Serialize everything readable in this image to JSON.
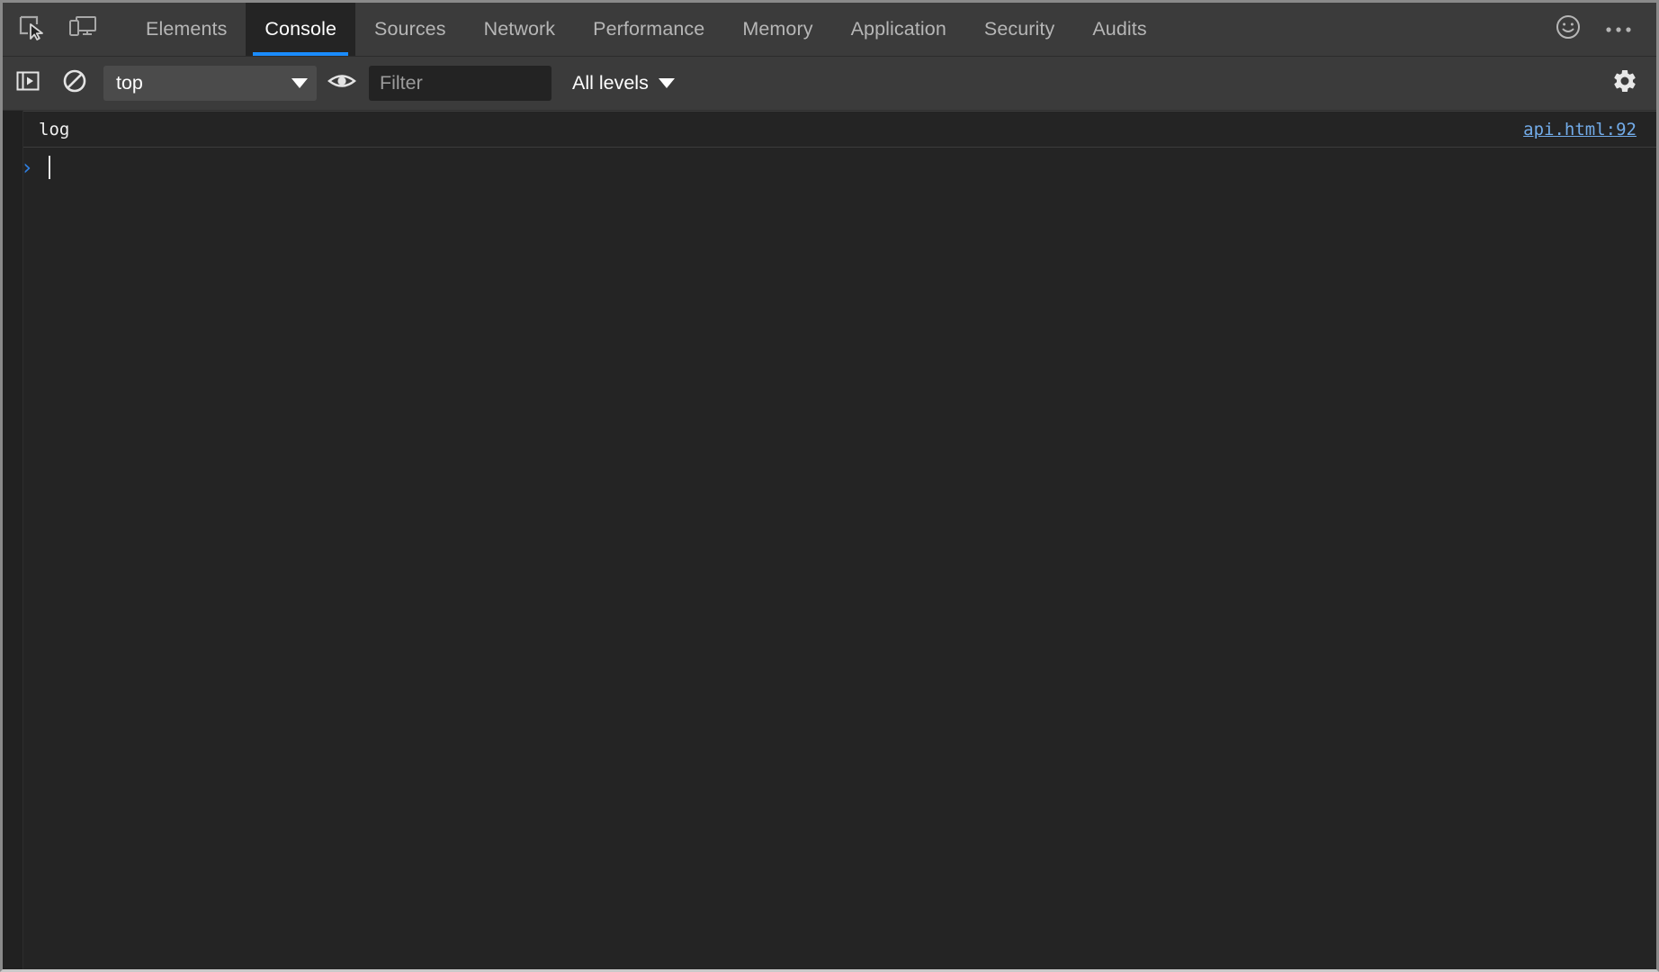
{
  "window": {
    "app": "Chrome DevTools",
    "theme": "dark",
    "accent_color": "#1a8cff",
    "background_color": "#242424",
    "toolbar_color": "#3b3b3b"
  },
  "tabbar": {
    "inspect_icon": "inspect-element-icon",
    "device_icon": "device-toolbar-icon",
    "tabs": [
      {
        "label": "Elements",
        "active": false
      },
      {
        "label": "Console",
        "active": true
      },
      {
        "label": "Sources",
        "active": false
      },
      {
        "label": "Network",
        "active": false
      },
      {
        "label": "Performance",
        "active": false
      },
      {
        "label": "Memory",
        "active": false
      },
      {
        "label": "Application",
        "active": false
      },
      {
        "label": "Security",
        "active": false
      },
      {
        "label": "Audits",
        "active": false
      }
    ],
    "feedback_icon": "smiley-face-icon",
    "more_icon": "more-options-icon"
  },
  "console_toolbar": {
    "sidebar_toggle_icon": "console-sidebar-toggle-icon",
    "clear_icon": "clear-console-icon",
    "context": {
      "value": "top",
      "caret_icon": "chevron-down-icon"
    },
    "live_expression_icon": "eye-icon",
    "filter": {
      "value": "",
      "placeholder": "Filter"
    },
    "levels": {
      "value": "All levels",
      "caret_icon": "chevron-down-icon"
    },
    "settings_icon": "gear-icon"
  },
  "console": {
    "messages": [
      {
        "text": "log",
        "source": "api.html:92",
        "source_color": "#72abe8",
        "level": "log"
      }
    ],
    "prompt": {
      "chevron": "›",
      "value": ""
    }
  }
}
